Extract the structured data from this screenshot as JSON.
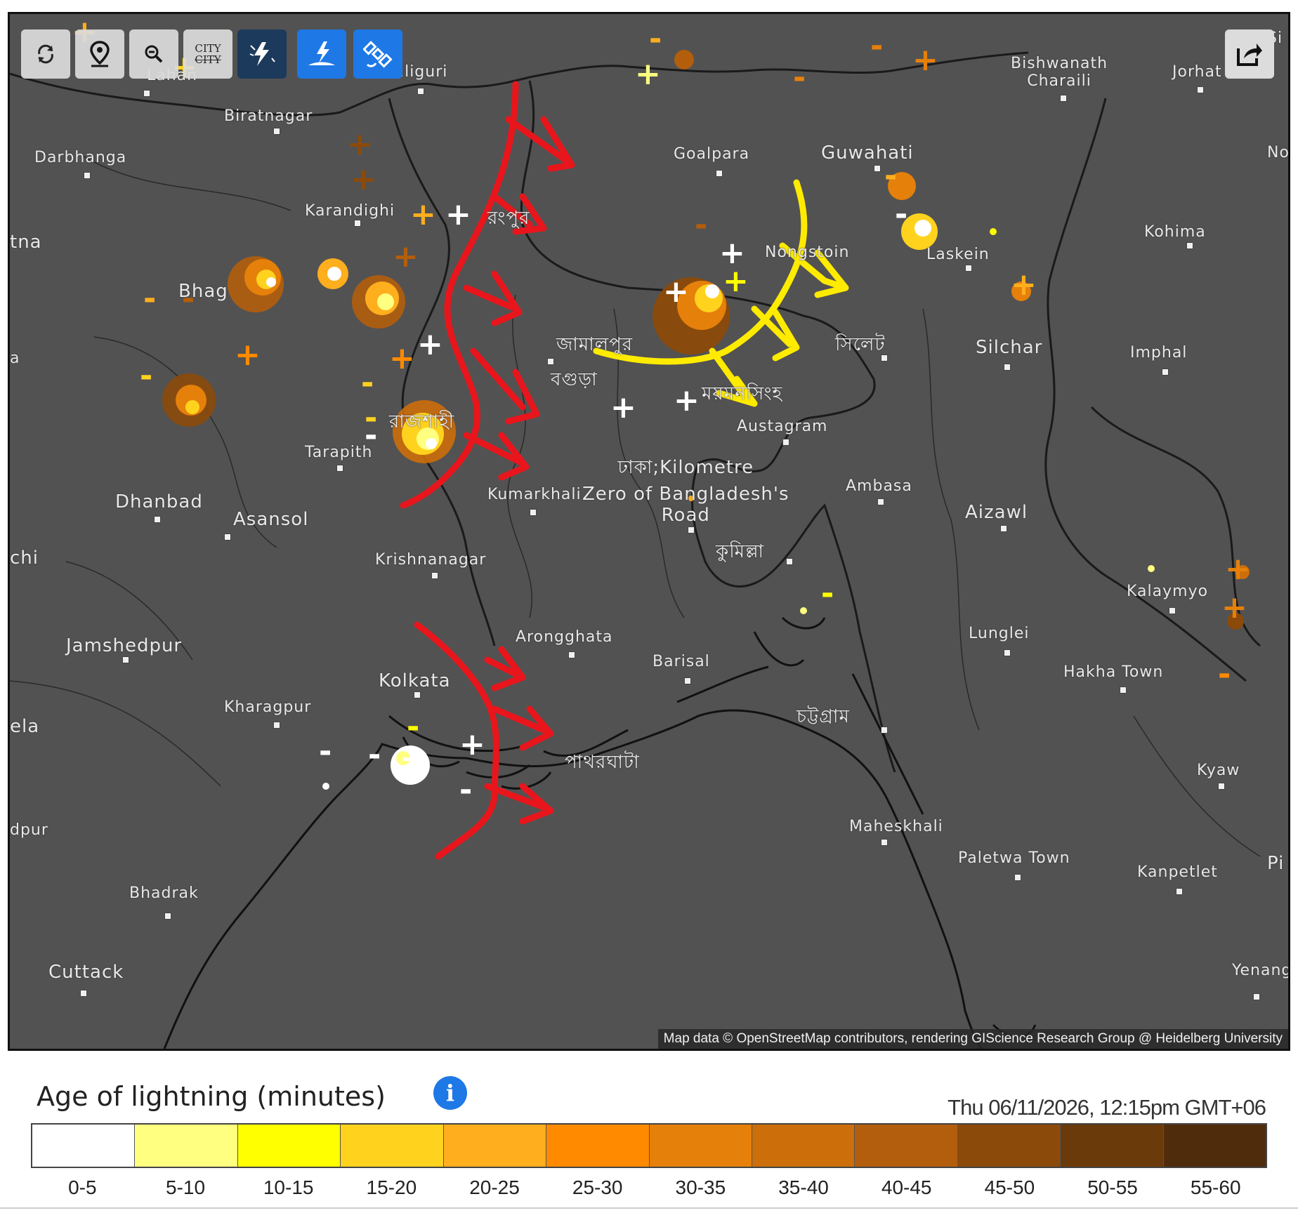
{
  "toolbar": {
    "buttons": [
      {
        "name": "refresh-button",
        "icon": "refresh-icon"
      },
      {
        "name": "location-button",
        "icon": "map-pin-icon"
      },
      {
        "name": "zoom-button",
        "icon": "zoom-out-icon"
      },
      {
        "name": "city-labels-button",
        "label_top": "CITY",
        "label_bottom": "CITY"
      },
      {
        "name": "lightning-button",
        "icon": "lightning-icon"
      },
      {
        "name": "ground-strike-button",
        "icon": "ground-strike-icon"
      },
      {
        "name": "satellite-button",
        "icon": "satellite-icon"
      }
    ],
    "share_icon": "share-icon"
  },
  "map": {
    "cities": [
      {
        "id": "lahan",
        "label": "Lahan"
      },
      {
        "id": "siliguri",
        "label": "Siliguri"
      },
      {
        "id": "bishwanath",
        "label": "Bishwanath\nCharaili"
      },
      {
        "id": "jorhat",
        "label": "Jorhat"
      },
      {
        "id": "biratnagar",
        "label": "Biratnagar"
      },
      {
        "id": "darbhanga",
        "label": "Darbhanga"
      },
      {
        "id": "goalpara",
        "label": "Goalpara"
      },
      {
        "id": "guwahati",
        "label": "Guwahati"
      },
      {
        "id": "karandighi",
        "label": "Karandighi"
      },
      {
        "id": "rangpur",
        "label": "রংপুর"
      },
      {
        "id": "kohima",
        "label": "Kohima"
      },
      {
        "id": "laskein",
        "label": "Laskein"
      },
      {
        "id": "meghalaya",
        "label": "Nongstoin"
      },
      {
        "id": "bhagalpur",
        "label": "Bhag"
      },
      {
        "id": "jamalpur",
        "label": "জামালপুর"
      },
      {
        "id": "sylhet",
        "label": "সিলেট"
      },
      {
        "id": "silchar",
        "label": "Silchar"
      },
      {
        "id": "imphal",
        "label": "Imphal"
      },
      {
        "id": "bogura",
        "label": "বগুড়া"
      },
      {
        "id": "mymensingh",
        "label": "ময়মনসিংহ"
      },
      {
        "id": "austagram",
        "label": "Austagram"
      },
      {
        "id": "rajshahi",
        "label": "রাজশাহী"
      },
      {
        "id": "tarapith",
        "label": "Tarapith"
      },
      {
        "id": "dhaka",
        "label": "ঢাকা;Kilometre\nZero of Bangladesh's\nRoad"
      },
      {
        "id": "kumarkhali",
        "label": "Kumarkhali"
      },
      {
        "id": "ambasa",
        "label": "Ambasa"
      },
      {
        "id": "aizawl",
        "label": "Aizawl"
      },
      {
        "id": "dhanbad",
        "label": "Dhanbad"
      },
      {
        "id": "asansol",
        "label": "Asansol"
      },
      {
        "id": "comilla",
        "label": "কুমিল্লা"
      },
      {
        "id": "krishnanagar",
        "label": "Krishnanagar"
      },
      {
        "id": "kalaymyo",
        "label": "Kalaymyo"
      },
      {
        "id": "jamshedpur",
        "label": "Jamshedpur"
      },
      {
        "id": "arongghata",
        "label": "Arongghata"
      },
      {
        "id": "lunglei",
        "label": "Lunglei"
      },
      {
        "id": "barisal",
        "label": "Barisal"
      },
      {
        "id": "hakha",
        "label": "Hakha Town"
      },
      {
        "id": "kolkata",
        "label": "Kolkata"
      },
      {
        "id": "kharagpur",
        "label": "Kharagpur"
      },
      {
        "id": "chattogram",
        "label": "চট্টগ্রাম"
      },
      {
        "id": "patharghata",
        "label": "পাথরঘাটা"
      },
      {
        "id": "kyaw",
        "label": "Kyaw"
      },
      {
        "id": "maheskhali",
        "label": "Maheskhali"
      },
      {
        "id": "paletwa",
        "label": "Paletwa Town"
      },
      {
        "id": "kanpetlet",
        "label": "Kanpetlet"
      },
      {
        "id": "bhadrak",
        "label": "Bhadrak"
      },
      {
        "id": "cuttack",
        "label": "Cuttack"
      },
      {
        "id": "yenang",
        "label": "Yenang"
      },
      {
        "id": "edge_na",
        "label": "tna"
      },
      {
        "id": "edge_chi",
        "label": "chi"
      },
      {
        "id": "edge_ela",
        "label": "ela"
      },
      {
        "id": "edge_dpur",
        "label": "dpur"
      },
      {
        "id": "edge_pi",
        "label": "Pi"
      },
      {
        "id": "edge_no",
        "label": "No"
      },
      {
        "id": "edge_si",
        "label": "Si"
      },
      {
        "id": "edge_a",
        "label": "a"
      }
    ],
    "attribution": "Map data © OpenStreetMap contributors, rendering GIScience Research Group @ Heidelberg University"
  },
  "legend": {
    "title": "Age of lightning (minutes)",
    "info_icon": "info-icon",
    "timestamp": "Thu 06/11/2026, 12:15pm GMT+06",
    "bins": [
      {
        "label": "0-5",
        "color": "#ffffff"
      },
      {
        "label": "5-10",
        "color": "#ffff80"
      },
      {
        "label": "10-15",
        "color": "#ffff00"
      },
      {
        "label": "15-20",
        "color": "#ffd21e"
      },
      {
        "label": "20-25",
        "color": "#ffae1e"
      },
      {
        "label": "25-30",
        "color": "#ff8a00"
      },
      {
        "label": "30-35",
        "color": "#e5800a"
      },
      {
        "label": "35-40",
        "color": "#cc6e0a"
      },
      {
        "label": "40-45",
        "color": "#b25e0c"
      },
      {
        "label": "45-50",
        "color": "#8c4a0a"
      },
      {
        "label": "50-55",
        "color": "#6b3a0a"
      },
      {
        "label": "55-60",
        "color": "#4f2c0c"
      }
    ]
  },
  "annotations": {
    "red_arrow_color": "#e8161c",
    "yellow_arrow_color": "#ffeb00"
  }
}
